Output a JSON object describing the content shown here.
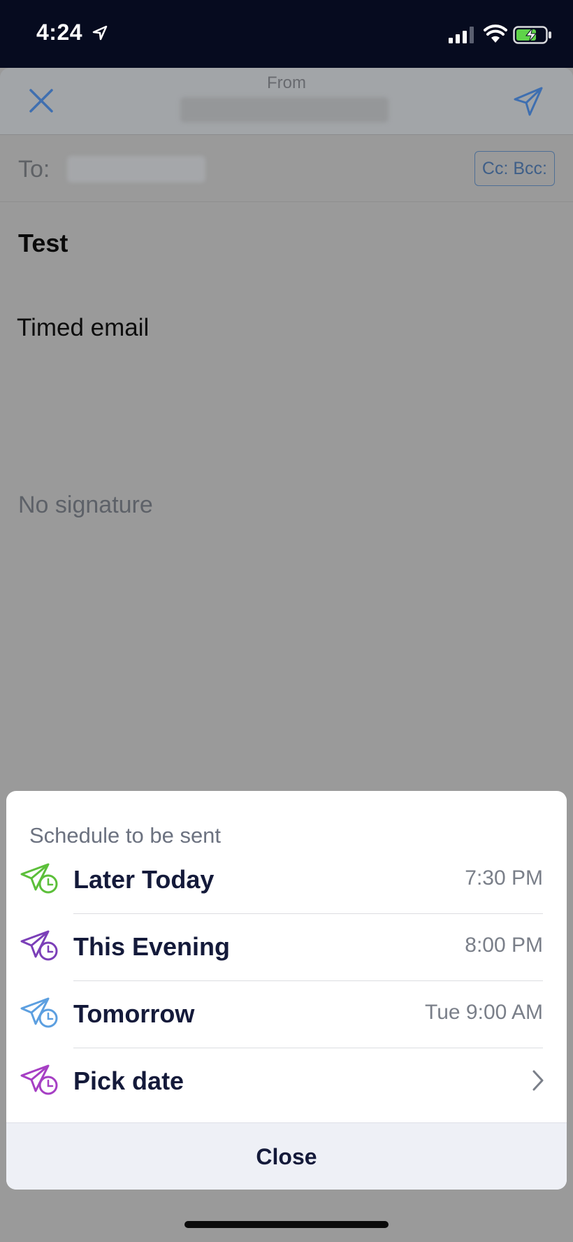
{
  "status_bar": {
    "time": "4:24",
    "location_icon": "location-arrow-icon",
    "signal_icon": "cellular-signal-icon",
    "wifi_icon": "wifi-icon",
    "battery_icon": "battery-charging-icon"
  },
  "compose": {
    "from_label": "From",
    "to_label": "To:",
    "cc_bcc_label": "Cc: Bcc:",
    "subject": "Test",
    "body": "Timed email",
    "signature": "No signature",
    "close_icon": "close-icon",
    "send_icon": "send-icon"
  },
  "schedule_sheet": {
    "title": "Schedule to be sent",
    "options": [
      {
        "label": "Later Today",
        "time": "7:30 PM",
        "icon": "scheduled-send-icon",
        "color": "#5cbf3a"
      },
      {
        "label": "This Evening",
        "time": "8:00 PM",
        "icon": "scheduled-send-icon",
        "color": "#7b3fb8"
      },
      {
        "label": "Tomorrow",
        "time": "Tue 9:00 AM",
        "icon": "scheduled-send-icon",
        "color": "#5c9fe0"
      },
      {
        "label": "Pick date",
        "time": "",
        "icon": "scheduled-send-icon",
        "color": "#a63fc4"
      }
    ],
    "close_label": "Close"
  },
  "colors": {
    "accent": "#3f6fb0",
    "text_primary": "#141a3a",
    "text_secondary": "#7a7f89"
  }
}
